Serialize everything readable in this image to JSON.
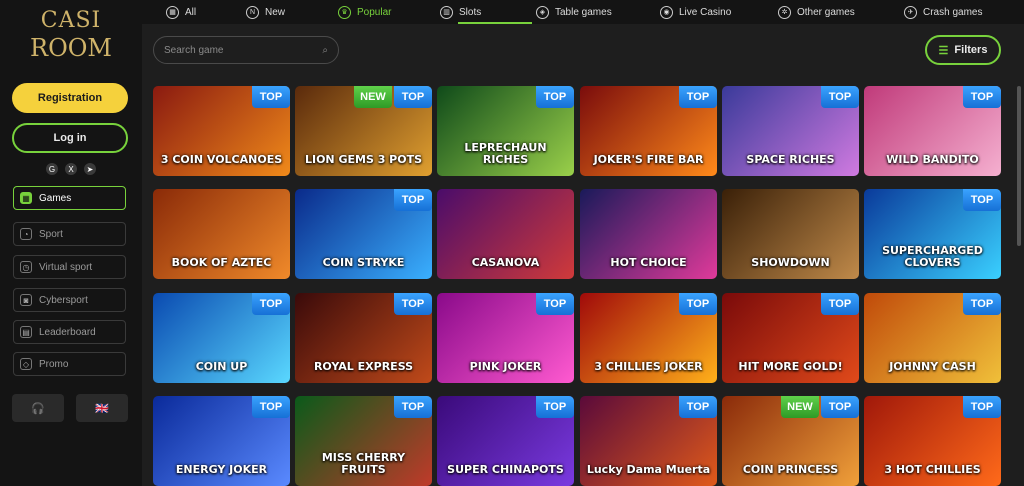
{
  "logo": {
    "line1": "CASI",
    "line2": "ROOM"
  },
  "sidebar": {
    "registration_label": "Registration",
    "login_label": "Log in",
    "socials": [
      {
        "icon": "google-icon",
        "glyph": "G"
      },
      {
        "icon": "x-icon",
        "glyph": "X"
      },
      {
        "icon": "telegram-icon",
        "glyph": "➤"
      }
    ],
    "items": [
      {
        "label": "Games",
        "icon": "games-icon",
        "glyph": "▦",
        "active": true
      },
      {
        "label": "Sport",
        "icon": "sport-icon",
        "glyph": "◔",
        "active": false
      },
      {
        "label": "Virtual sport",
        "icon": "virtual-sport-icon",
        "glyph": "◷",
        "active": false
      },
      {
        "label": "Cybersport",
        "icon": "cybersport-icon",
        "glyph": "◙",
        "active": false
      },
      {
        "label": "Leaderboard",
        "icon": "leaderboard-icon",
        "glyph": "▤",
        "active": false
      },
      {
        "label": "Promo",
        "icon": "promo-icon",
        "glyph": "◇",
        "active": false
      }
    ],
    "support_glyph": "🎧",
    "language_glyph": "🇬🇧"
  },
  "tabs": [
    {
      "label": "All",
      "icon": "all-icon",
      "glyph": "▦"
    },
    {
      "label": "New",
      "icon": "new-icon",
      "glyph": "N"
    },
    {
      "label": "Popular",
      "icon": "popular-icon",
      "glyph": "♛",
      "active": true
    },
    {
      "label": "Slots",
      "icon": "slots-icon",
      "glyph": "▥"
    },
    {
      "label": "Table games",
      "icon": "table-games-icon",
      "glyph": "◈"
    },
    {
      "label": "Live Casino",
      "icon": "live-casino-icon",
      "glyph": "◉"
    },
    {
      "label": "Other games",
      "icon": "other-games-icon",
      "glyph": "✲"
    },
    {
      "label": "Crash games",
      "icon": "crash-games-icon",
      "glyph": "✈"
    }
  ],
  "search": {
    "placeholder": "Search game"
  },
  "filters_label": "Filters",
  "badges": {
    "top": "TOP",
    "new": "NEW"
  },
  "games": [
    {
      "name": "3 COIN VOLCANOES",
      "top": true,
      "new": false,
      "colors": [
        "#8a1a10",
        "#f08a1a"
      ]
    },
    {
      "name": "LION GEMS 3 POTS",
      "top": true,
      "new": true,
      "colors": [
        "#5a2a0c",
        "#e0a030"
      ]
    },
    {
      "name": "LEPRECHAUN RICHES",
      "top": true,
      "new": false,
      "colors": [
        "#0f4a1a",
        "#9ad04a"
      ]
    },
    {
      "name": "JOKER'S FIRE BAR",
      "top": true,
      "new": false,
      "colors": [
        "#7a0c0c",
        "#ff8a1a"
      ]
    },
    {
      "name": "SPACE RICHES",
      "top": true,
      "new": false,
      "colors": [
        "#3a3a9a",
        "#d07ae0"
      ]
    },
    {
      "name": "WILD BANDITO",
      "top": true,
      "new": false,
      "colors": [
        "#c03a7a",
        "#f5b0d0"
      ]
    },
    {
      "name": "BOOK OF AZTEC",
      "top": false,
      "new": false,
      "colors": [
        "#8a2a08",
        "#f08a2a"
      ]
    },
    {
      "name": "COIN STRYKE",
      "top": true,
      "new": false,
      "colors": [
        "#0a2a8a",
        "#3ab0ff"
      ]
    },
    {
      "name": "CASANOVA",
      "top": false,
      "new": false,
      "colors": [
        "#4a0c6a",
        "#d03a3a"
      ]
    },
    {
      "name": "HOT CHOICE",
      "top": false,
      "new": false,
      "colors": [
        "#1a1a5a",
        "#e03a9a"
      ]
    },
    {
      "name": "SHOWDOWN",
      "top": false,
      "new": false,
      "colors": [
        "#3a2008",
        "#c08a4a"
      ]
    },
    {
      "name": "SUPERCHARGED CLOVERS",
      "top": true,
      "new": false,
      "colors": [
        "#0a3a9a",
        "#3ad0ff"
      ]
    },
    {
      "name": "COIN UP",
      "top": true,
      "new": false,
      "colors": [
        "#0a4ab0",
        "#5ad8ff"
      ]
    },
    {
      "name": "ROYAL EXPRESS",
      "top": true,
      "new": false,
      "colors": [
        "#3a0a0a",
        "#c04a1a"
      ]
    },
    {
      "name": "PINK JOKER",
      "top": true,
      "new": false,
      "colors": [
        "#8a0a8a",
        "#ff5ad0"
      ]
    },
    {
      "name": "3 CHILLIES JOKER",
      "top": true,
      "new": false,
      "colors": [
        "#a00a0a",
        "#ffb01a"
      ]
    },
    {
      "name": "HIT MORE GOLD!",
      "top": true,
      "new": false,
      "colors": [
        "#7a0a0a",
        "#e04a1a"
      ]
    },
    {
      "name": "JOHNNY CASH",
      "top": true,
      "new": false,
      "colors": [
        "#c04a0a",
        "#f0c03a"
      ]
    },
    {
      "name": "ENERGY JOKER",
      "top": true,
      "new": false,
      "colors": [
        "#0a2a9a",
        "#5a8aff"
      ]
    },
    {
      "name": "MISS CHERRY FRUITS",
      "top": true,
      "new": false,
      "colors": [
        "#0a5a1a",
        "#c03a2a"
      ]
    },
    {
      "name": "SUPER CHINAPOTS",
      "top": true,
      "new": false,
      "colors": [
        "#3a0a7a",
        "#7a3ae0"
      ]
    },
    {
      "name": "Lucky Dama Muerta",
      "top": true,
      "new": false,
      "colors": [
        "#5a0a3a",
        "#e05a1a"
      ]
    },
    {
      "name": "COIN PRINCESS",
      "top": true,
      "new": true,
      "colors": [
        "#8a2a0a",
        "#f0a03a"
      ]
    },
    {
      "name": "3 HOT CHILLIES",
      "top": true,
      "new": false,
      "colors": [
        "#a0180a",
        "#ff6a1a"
      ]
    }
  ]
}
